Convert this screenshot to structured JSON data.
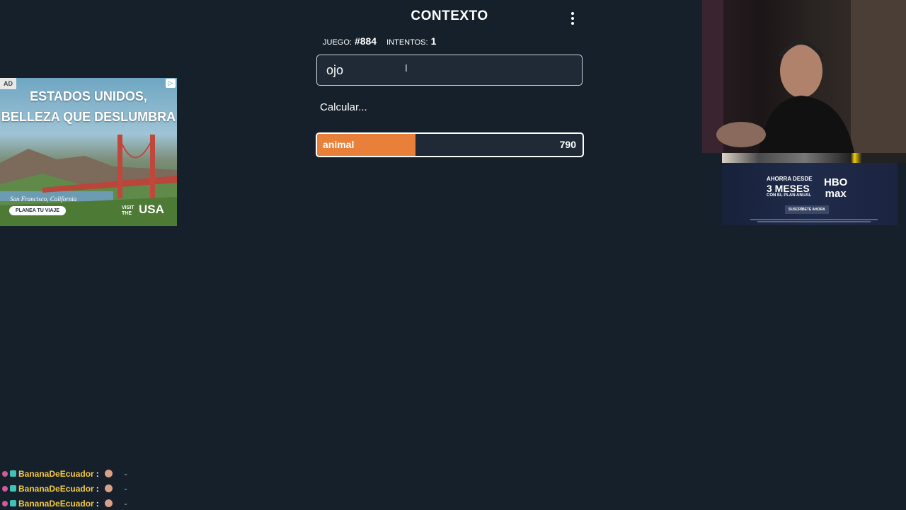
{
  "app": {
    "title": "CONTEXTO",
    "menu_icon": "kebab-menu-icon"
  },
  "stats": {
    "game_label": "JUEGO:",
    "game_number": "#884",
    "attempts_label": "INTENTOS:",
    "attempts_count": "1"
  },
  "guess_input": {
    "value": "ojo",
    "placeholder": ""
  },
  "status_text": "Calcular...",
  "guesses": [
    {
      "word": "animal",
      "rank": "790",
      "fill_fraction": 0.37,
      "color": "#e9803a"
    }
  ],
  "ad_left": {
    "badge": "AD",
    "headline_1": "ESTADOS UNIDOS,",
    "headline_2": "BELLEZA QUE DESLUMBRA",
    "caption": "San Francisco, California",
    "cta": "PLANEA TU VIAJE",
    "brand_small_1": "VISIT",
    "brand_small_2": "THE",
    "brand_big": "USA"
  },
  "ad_right": {
    "pre": "AHORRA DESDE",
    "main": "3 MESES",
    "sub": "CON EL PLAN ANUAL",
    "logo_1": "HBO",
    "logo_2": "max",
    "cta": "SUSCRÍBETE AHORA"
  },
  "chat": [
    {
      "user": "BananaDeEcuador",
      "colon": ":"
    },
    {
      "user": "BananaDeEcuador",
      "colon": ":"
    },
    {
      "user": "BananaDeEcuador",
      "colon": ":"
    }
  ],
  "colors": {
    "background": "#15202b",
    "accent_orange": "#e9803a",
    "chat_username": "#f5c842"
  }
}
